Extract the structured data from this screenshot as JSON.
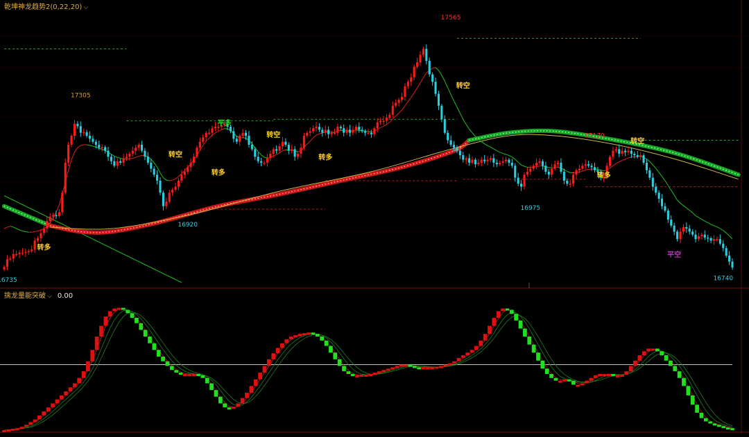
{
  "indicator_main": {
    "title": "乾坤神龙趋势2(0,22,20)"
  },
  "indicator_osc": {
    "title": "擒龙量能突破",
    "value": "0.00"
  },
  "colors": {
    "up": "#ff1a1a",
    "down": "#2ad0e0",
    "osc_up": "#e01010",
    "osc_down": "#20e020",
    "ma_red": "#e02020",
    "ma_green": "#20c020",
    "ma_yellow": "#c8b84a",
    "zero_line": "#c8c8c8"
  },
  "chart_data": [
    {
      "type": "candlestick",
      "ylim": [
        16700,
        17620
      ],
      "price_labels": [
        {
          "text": "17565",
          "x": 146,
          "y": 17565,
          "color": "#ff3030",
          "kind": "high"
        },
        {
          "text": "17305",
          "x": 25,
          "y": 17305,
          "color": "#e0a020",
          "kind": "high"
        },
        {
          "text": "17170",
          "x": 193,
          "y": 17170,
          "color": "#ff3030",
          "kind": "high"
        },
        {
          "text": "16920",
          "x": 60,
          "y": 16920,
          "color": "#30d0e0",
          "kind": "low"
        },
        {
          "text": "16975",
          "x": 172,
          "y": 16975,
          "color": "#30d0e0",
          "kind": "low"
        },
        {
          "text": "16735",
          "x": 1,
          "y": 16735,
          "color": "#30d0e0",
          "kind": "low"
        },
        {
          "text": "16740",
          "x": 235,
          "y": 16740,
          "color": "#30d0e0",
          "kind": "low"
        }
      ],
      "signals": [
        {
          "text": "转多",
          "x": 13,
          "y": 16810,
          "color": "#ffd020"
        },
        {
          "text": "转空",
          "x": 56,
          "y": 17120,
          "color": "#ffd020"
        },
        {
          "text": "转多",
          "x": 70,
          "y": 17060,
          "color": "#ffd020"
        },
        {
          "text": "平多",
          "x": 72,
          "y": 17225,
          "color": "#20d020"
        },
        {
          "text": "转空",
          "x": 88,
          "y": 17185,
          "color": "#ffd020"
        },
        {
          "text": "转多",
          "x": 105,
          "y": 17110,
          "color": "#ffd020"
        },
        {
          "text": "转空",
          "x": 150,
          "y": 17350,
          "color": "#ffd020"
        },
        {
          "text": "转多",
          "x": 196,
          "y": 17050,
          "color": "#ffd020"
        },
        {
          "text": "转空",
          "x": 207,
          "y": 17165,
          "color": "#ffd020"
        },
        {
          "text": "平空",
          "x": 219,
          "y": 16785,
          "color": "#c030c0"
        }
      ],
      "levels": [
        {
          "x0": 0,
          "x1": 40,
          "y": 17480,
          "color": "#30a030"
        },
        {
          "x0": 40,
          "x1": 88,
          "y": 17240,
          "color": "#30a030"
        },
        {
          "x0": 88,
          "x1": 148,
          "y": 17245,
          "color": "#30a030"
        },
        {
          "x0": 148,
          "x1": 208,
          "y": 17515,
          "color": "#30a030"
        },
        {
          "x0": 208,
          "x1": 240,
          "y": 17175,
          "color": "#30a030"
        },
        {
          "x0": 68,
          "x1": 105,
          "y": 16945,
          "color": "#a02020"
        },
        {
          "x0": 105,
          "x1": 148,
          "y": 17040,
          "color": "#a02020"
        },
        {
          "x0": 150,
          "x1": 190,
          "y": 17045,
          "color": "#a02020"
        },
        {
          "x0": 190,
          "x1": 240,
          "y": 17020,
          "color": "#a02020"
        }
      ],
      "close": [
        16752,
        16778,
        16780,
        16795,
        16795,
        16800,
        16800,
        16802,
        16805,
        16810,
        16840,
        16848,
        16865,
        16880,
        16905,
        16920,
        16925,
        16922,
        16935,
        17000,
        17100,
        17160,
        17190,
        17230,
        17222,
        17200,
        17202,
        17190,
        17180,
        17170,
        17160,
        17150,
        17152,
        17140,
        17120,
        17105,
        17090,
        17105,
        17100,
        17115,
        17120,
        17130,
        17140,
        17150,
        17160,
        17140,
        17120,
        17100,
        17080,
        17060,
        17040,
        17000,
        16955,
        16970,
        17000,
        17010,
        17020,
        17040,
        17060,
        17070,
        17085,
        17100,
        17120,
        17150,
        17170,
        17185,
        17200,
        17200,
        17215,
        17220,
        17220,
        17225,
        17230,
        17220,
        17205,
        17180,
        17170,
        17190,
        17200,
        17190,
        17160,
        17145,
        17120,
        17105,
        17100,
        17100,
        17115,
        17130,
        17145,
        17140,
        17155,
        17170,
        17160,
        17140,
        17145,
        17120,
        17130,
        17150,
        17190,
        17200,
        17205,
        17215,
        17220,
        17210,
        17200,
        17210,
        17195,
        17200,
        17200,
        17220,
        17215,
        17200,
        17210,
        17200,
        17210,
        17220,
        17210,
        17205,
        17200,
        17200,
        17195,
        17215,
        17235,
        17240,
        17240,
        17250,
        17260,
        17290,
        17300,
        17310,
        17320,
        17355,
        17370,
        17385,
        17420,
        17435,
        17460,
        17480,
        17440,
        17395,
        17370,
        17330,
        17290,
        17245,
        17200,
        17175,
        17160,
        17150,
        17140,
        17125,
        17110,
        17115,
        17100,
        17110,
        17095,
        17100,
        17110,
        17105,
        17110,
        17115,
        17100,
        17095,
        17100,
        17105,
        17110,
        17100,
        17090,
        17050,
        17030,
        17020,
        17060,
        17070,
        17080,
        17090,
        17100,
        17105,
        17090,
        17070,
        17060,
        17080,
        17095,
        17100,
        17070,
        17040,
        17030,
        17030,
        17060,
        17075,
        17080,
        17090,
        17095,
        17090,
        17085,
        17075,
        17070,
        17050,
        17055,
        17090,
        17120,
        17140,
        17145,
        17130,
        17140,
        17135,
        17140,
        17130,
        17125,
        17120,
        17125,
        17100,
        17075,
        17050,
        17020,
        17000,
        16980,
        16955,
        16940,
        16910,
        16890,
        16870,
        16845,
        16870,
        16885,
        16880,
        16870,
        16860,
        16845,
        16855,
        16860,
        16850,
        16848,
        16840,
        16845,
        16845,
        16830,
        16815,
        16790,
        16770,
        16750
      ],
      "ma_red": [
        16880,
        16885,
        16888,
        16885,
        16880,
        16876,
        16872,
        16870,
        16868,
        16868,
        16870,
        16872,
        16875,
        16880,
        16888,
        16900,
        16915,
        16935,
        16960,
        16995,
        17035,
        17075,
        17110,
        17135,
        17150,
        17158,
        17160,
        17160,
        17158,
        17155,
        17152,
        17148,
        17145,
        17140,
        17135,
        17128,
        17122,
        17118,
        17115,
        17113,
        17112,
        17113,
        17115,
        17118,
        17122,
        17124,
        17124,
        17120,
        17112,
        17100,
        17085,
        17066,
        17050,
        17042,
        17040,
        17042,
        17046,
        17054,
        17064,
        17074,
        17085,
        17096,
        17110,
        17125,
        17142,
        17158,
        17172,
        17182,
        17192,
        17200,
        17205,
        17210,
        17214,
        17213,
        17208,
        17198,
        17188,
        17184,
        17184,
        17182,
        17174,
        17164,
        17150,
        17137,
        17126,
        17118,
        17116,
        17118,
        17123,
        17127,
        17133,
        17140,
        17143,
        17142,
        17143,
        17139,
        17137,
        17140,
        17151,
        17162,
        17172,
        17183,
        17192,
        17197,
        17199,
        17203,
        17202,
        17202,
        17201,
        17206,
        17208,
        17206,
        17207,
        17205,
        17206,
        17209,
        17208,
        17207,
        17205,
        17204,
        17202,
        17205,
        17211,
        17217,
        17222,
        17228,
        17235,
        17246,
        17256,
        17266,
        17276,
        17290,
        17304,
        17318,
        17334,
        17350,
        17366,
        17384,
        17400,
        17408,
        17415,
        17418,
        17408,
        17392,
        17372,
        17350,
        17328,
        17306,
        17286,
        17265,
        17245,
        17228,
        17212,
        17200,
        17188,
        17178,
        17170,
        17163,
        17157,
        17152,
        17146,
        17140,
        17135,
        17131,
        17128,
        17124,
        17119,
        17111,
        17102,
        17092,
        17088,
        17085,
        17084,
        17085,
        17087,
        17089,
        17089,
        17087,
        17084,
        17083,
        17084,
        17085,
        17082,
        17077,
        17071,
        17067,
        17066,
        17067,
        17069,
        17072,
        17076,
        17078,
        17079,
        17079,
        17078,
        17075,
        17073,
        17076,
        17082,
        17090,
        17098,
        17103,
        17108,
        17112,
        17116,
        17119,
        17120,
        17120,
        17121,
        17118,
        17112,
        17104,
        17093,
        17081,
        17068,
        17054,
        17040,
        17024,
        17008,
        16992,
        16975,
        16965,
        16957,
        16949,
        16941,
        16933,
        16923,
        16917,
        16911,
        16905,
        16900,
        16894,
        16890,
        16886,
        16880,
        16874,
        16866,
        16856,
        16846
      ],
      "ma_green_long": [
        16990,
        16985,
        16980,
        16975,
        16970,
        16965,
        16960,
        16955,
        16950,
        16945,
        16940,
        16935,
        16930,
        16925,
        16920,
        16915,
        16910,
        16905,
        16900,
        16895,
        16890,
        16885,
        16880,
        16875,
        16870,
        16865,
        16860,
        16855,
        16850,
        16845,
        16840,
        16835,
        16830,
        16825,
        16820,
        16815,
        16810,
        16805,
        16800,
        16795,
        16790,
        16785,
        16780,
        16775,
        16770,
        16765,
        16760,
        16755,
        16750,
        16745,
        16740,
        16735,
        16730,
        16725,
        16720,
        16715,
        16710,
        16705,
        16700,
        16695,
        16690,
        16685,
        16680,
        16675,
        16670,
        16665,
        16660,
        16655,
        16650,
        16645,
        16640,
        16635,
        16630,
        16625,
        16620,
        16615,
        16610,
        16605,
        16600,
        16595,
        16590,
        16585,
        16580,
        16575,
        16570,
        16565,
        16560,
        16555,
        16550,
        16545,
        16540,
        16535,
        16530,
        16525,
        16520,
        16515,
        16510,
        16505,
        16500,
        16495,
        16490,
        16485,
        16480,
        16475,
        16470,
        16465,
        16460,
        16455,
        16450,
        16445,
        16440,
        16435,
        16430,
        16425,
        16420,
        16415,
        16410,
        16405,
        16400,
        16395,
        16390,
        16385,
        16380,
        16375,
        16370,
        16365,
        16360,
        16355,
        16350,
        16345,
        16340,
        16335,
        16330,
        16325,
        16320,
        16315,
        16310,
        16305,
        16300,
        16295,
        16290,
        16285,
        16280,
        16275,
        16270,
        16265,
        16260,
        16255,
        16250,
        16245,
        16240,
        16235,
        16230,
        16225,
        16220,
        16215,
        16210,
        16205,
        16200,
        16195,
        16190,
        16185,
        16180,
        16175,
        16170,
        16165,
        16160,
        16155,
        16150,
        16145,
        16140,
        16135,
        16130,
        16125,
        16120,
        16115,
        16110,
        16105,
        16100,
        16095,
        16090,
        16085,
        16080,
        16075,
        16070,
        16065,
        16060,
        16055,
        16050,
        16045,
        16040,
        16035,
        16030,
        16025,
        16020,
        16015,
        16010,
        16005,
        16000,
        15995,
        15990,
        15985,
        15980,
        15975,
        15970,
        15965,
        15960,
        15955,
        15950,
        15945,
        15940,
        15935,
        15930,
        15925,
        15920,
        15915,
        15910,
        15905,
        15900,
        15895,
        15890,
        15885,
        15880,
        15875,
        15870,
        15865,
        15860,
        15855,
        15850,
        15845,
        15840,
        15835,
        15830,
        15825
      ],
      "ribbon": [
        {
          "x": 0,
          "y": 16955,
          "state": "down"
        },
        {
          "x": 15,
          "y": 16890,
          "state": "up"
        },
        {
          "x": 25,
          "y": 16870,
          "state": "up"
        },
        {
          "x": 35,
          "y": 16870,
          "state": "up"
        },
        {
          "x": 50,
          "y": 16900,
          "state": "up"
        },
        {
          "x": 70,
          "y": 16955,
          "state": "up"
        },
        {
          "x": 90,
          "y": 16995,
          "state": "up"
        },
        {
          "x": 110,
          "y": 17040,
          "state": "up"
        },
        {
          "x": 130,
          "y": 17085,
          "state": "up"
        },
        {
          "x": 147,
          "y": 17140,
          "state": "up"
        },
        {
          "x": 152,
          "y": 17175,
          "state": "down"
        },
        {
          "x": 165,
          "y": 17200,
          "state": "down"
        },
        {
          "x": 180,
          "y": 17205,
          "state": "down"
        },
        {
          "x": 200,
          "y": 17175,
          "state": "down"
        },
        {
          "x": 220,
          "y": 17130,
          "state": "down"
        },
        {
          "x": 240,
          "y": 17060,
          "state": "down"
        }
      ],
      "ma_yellow": [
        {
          "x": 15,
          "y": 16885
        },
        {
          "x": 35,
          "y": 16880
        },
        {
          "x": 60,
          "y": 16925
        },
        {
          "x": 90,
          "y": 17005
        },
        {
          "x": 120,
          "y": 17070
        },
        {
          "x": 147,
          "y": 17148
        },
        {
          "x": 165,
          "y": 17190
        },
        {
          "x": 180,
          "y": 17190
        },
        {
          "x": 200,
          "y": 17160
        },
        {
          "x": 220,
          "y": 17110
        },
        {
          "x": 240,
          "y": 17045
        }
      ]
    },
    {
      "type": "bar",
      "ylim": [
        -1,
        1
      ],
      "zero": 0,
      "osc": [
        -0.98,
        -0.97,
        -0.96,
        -0.95,
        -0.93,
        -0.9,
        -0.86,
        -0.82,
        -0.76,
        -0.7,
        -0.64,
        -0.58,
        -0.52,
        -0.46,
        -0.4,
        -0.34,
        -0.28,
        -0.2,
        -0.1,
        0.05,
        0.22,
        0.42,
        0.58,
        0.72,
        0.8,
        0.84,
        0.85,
        0.82,
        0.77,
        0.7,
        0.62,
        0.52,
        0.42,
        0.32,
        0.22,
        0.12,
        0.05,
        -0.02,
        -0.08,
        -0.12,
        -0.14,
        -0.14,
        -0.14,
        -0.14,
        -0.16,
        -0.2,
        -0.28,
        -0.38,
        -0.48,
        -0.58,
        -0.64,
        -0.66,
        -0.63,
        -0.58,
        -0.5,
        -0.42,
        -0.32,
        -0.22,
        -0.12,
        -0.02,
        0.08,
        0.17,
        0.25,
        0.32,
        0.38,
        0.42,
        0.44,
        0.46,
        0.47,
        0.48,
        0.46,
        0.42,
        0.36,
        0.28,
        0.18,
        0.08,
        -0.02,
        -0.1,
        -0.14,
        -0.16,
        -0.16,
        -0.15,
        -0.15,
        -0.14,
        -0.12,
        -0.1,
        -0.08,
        -0.06,
        -0.04,
        -0.02,
        0,
        0,
        -0.02,
        -0.04,
        -0.05,
        -0.04,
        -0.04,
        -0.04,
        -0.03,
        -0.02,
        0,
        0.02,
        0.05,
        0.1,
        0.14,
        0.18,
        0.22,
        0.28,
        0.36,
        0.46,
        0.58,
        0.7,
        0.8,
        0.84,
        0.82,
        0.76,
        0.66,
        0.54,
        0.42,
        0.3,
        0.18,
        0.06,
        -0.06,
        -0.14,
        -0.2,
        -0.24,
        -0.24,
        -0.22,
        -0.24,
        -0.3,
        -0.3,
        -0.28,
        -0.24,
        -0.2,
        -0.16,
        -0.14,
        -0.14,
        -0.14,
        -0.16,
        -0.16,
        -0.15,
        -0.1,
        -0.02,
        0.06,
        0.14,
        0.2,
        0.24,
        0.24,
        0.2,
        0.14,
        0.06,
        -0.02,
        -0.1,
        -0.2,
        -0.32,
        -0.46,
        -0.6,
        -0.72,
        -0.8,
        -0.85,
        -0.88,
        -0.9,
        -0.92,
        -0.94,
        -0.95,
        -0.96
      ]
    }
  ]
}
